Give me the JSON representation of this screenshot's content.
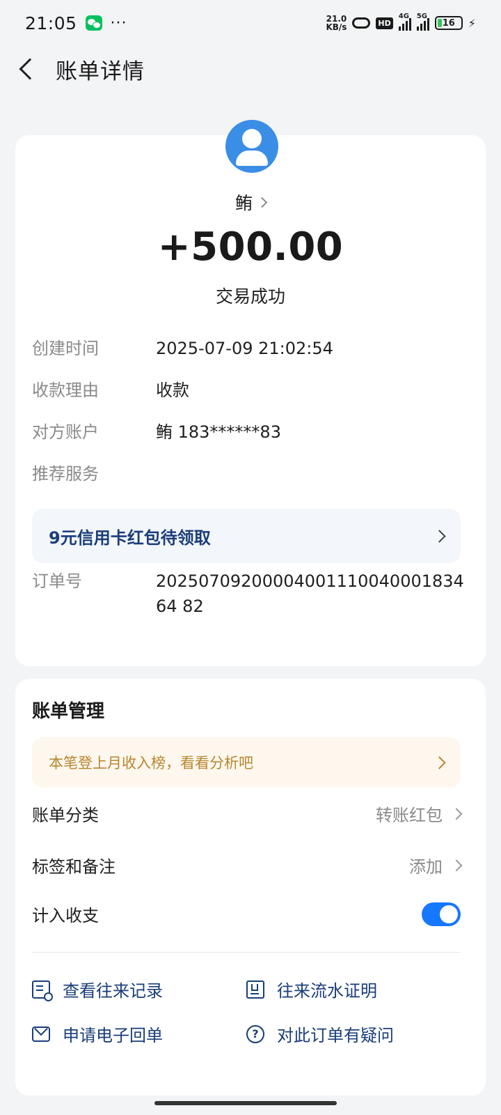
{
  "status_bar": {
    "time": "21:05",
    "more": "···",
    "net_speed_value": "21.0",
    "net_speed_unit": "KB/s",
    "hd": "HD",
    "signal1_label": "4G",
    "signal2_label": "5G",
    "battery": "16",
    "icons": [
      "wechat-icon",
      "link-icon",
      "signal-icon",
      "battery-icon",
      "charging-bolt-icon"
    ]
  },
  "header": {
    "title": "账单详情",
    "back_icon": "chevron-left-icon"
  },
  "transaction": {
    "payer": "鲔",
    "amount": "+500.00",
    "status": "交易成功"
  },
  "details": {
    "created_label": "创建时间",
    "created_value": "2025-07-09 21:02:54",
    "reason_label": "收款理由",
    "reason_value": "收款",
    "account_label": "对方账户",
    "account_value": "鲔 183******83",
    "recommend_label": "推荐服务",
    "promo": "9元信用卡红包待领取",
    "order_label": "订单号",
    "order_value": "2025070920000400111004000183464 82"
  },
  "manage": {
    "title": "账单管理",
    "analysis_banner": "本笔登上月收入榜，看看分析吧",
    "category_label": "账单分类",
    "category_value": "转账红包",
    "tags_label": "标签和备注",
    "tags_value": "添加",
    "count_label": "计入收支",
    "count_enabled": true,
    "actions": {
      "history": "查看往来记录",
      "proof": "往来流水证明",
      "receipt": "申请电子回单",
      "question": "对此订单有疑问"
    }
  },
  "colors": {
    "accent": "#1677ff",
    "link": "#1a3d79",
    "avatar": "#3a8ee6",
    "banner_gold": "#b8862e"
  }
}
